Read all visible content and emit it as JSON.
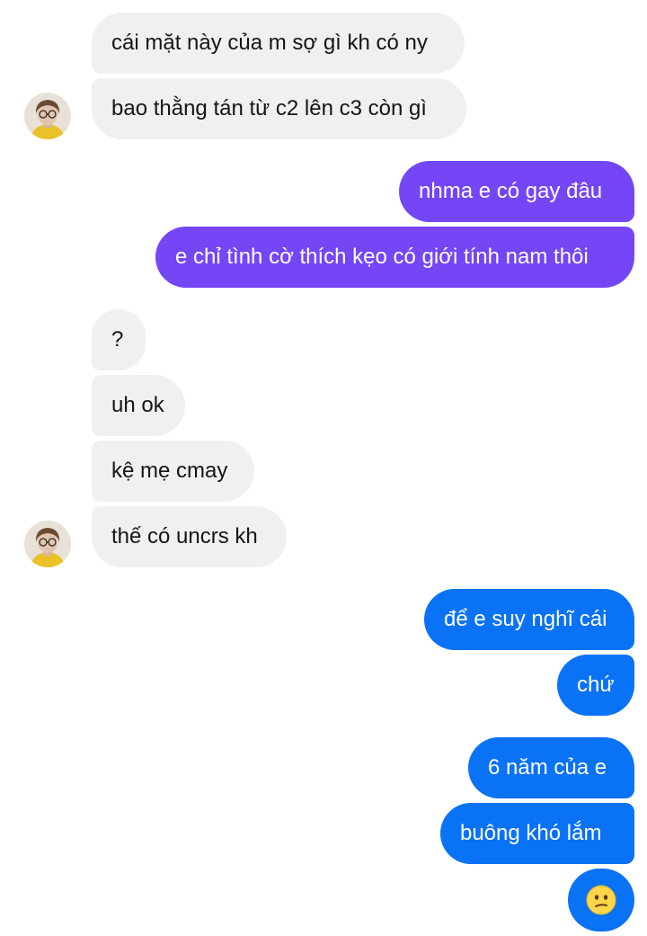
{
  "incoming_group_1": {
    "messages": [
      "cái mặt này của m sợ gì kh có ny",
      "bao thằng tán từ c2 lên c3 còn gì"
    ]
  },
  "outgoing_group_1": {
    "messages": [
      "nhma e có gay đâu",
      "e chỉ tình cờ thích kẹo có giới tính nam thôi"
    ]
  },
  "incoming_group_2": {
    "messages": [
      "?",
      "uh ok",
      "kệ mẹ cmay",
      "thế có uncrs kh"
    ]
  },
  "outgoing_group_2": {
    "messages": [
      "để e suy nghĩ cái",
      "chứ",
      "6 năm của e",
      "buông khó lắm"
    ],
    "emoji": "confused-face-emoji"
  },
  "colors": {
    "incoming_bubble": "#f0f0f3",
    "outgoing_purple": "#7446f6",
    "outgoing_blue": "#0a72f5",
    "incoming_text": "#151515",
    "outgoing_text": "#ffffff"
  }
}
